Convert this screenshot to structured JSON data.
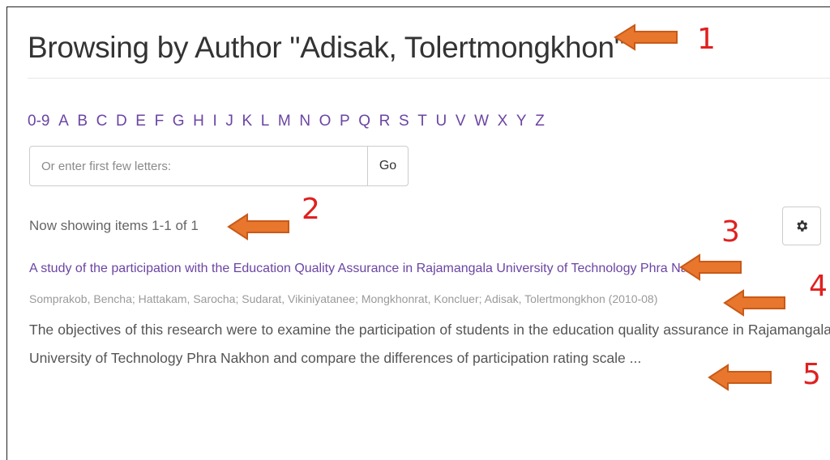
{
  "page": {
    "title": "Browsing by Author \"Adisak, Tolertmongkhon\""
  },
  "browse": {
    "letters": [
      "0-9",
      "A",
      "B",
      "C",
      "D",
      "E",
      "F",
      "G",
      "H",
      "I",
      "J",
      "K",
      "L",
      "M",
      "N",
      "O",
      "P",
      "Q",
      "R",
      "S",
      "T",
      "U",
      "V",
      "W",
      "X",
      "Y",
      "Z"
    ],
    "search_placeholder": "Or enter first few letters:",
    "go_label": "Go"
  },
  "results": {
    "showing_text": "Now showing items 1-1 of 1",
    "item": {
      "title": "A study of the participation with the Education Quality Assurance in Rajamangala University of Technology Phra Nakhon",
      "authors_date": "Somprakob, Bencha; Hattakam, Sarocha; Sudarat, Vikiniyatanee; Mongkhonrat, Koncluer; Adisak, Tolertmongkhon (2010-08)",
      "abstract": "The objectives of this research were to examine the participation of students in the education quality assurance in Rajamangala University of Technology Phra Nakhon and compare the differences of participation rating scale ..."
    }
  },
  "annotations": {
    "labels": [
      "1",
      "2",
      "3",
      "4",
      "5"
    ],
    "arrow_color": "#e8762d",
    "arrow_outline": "#c85a18",
    "label_color": "#e02020"
  },
  "icons": {
    "settings": "gear-icon"
  }
}
